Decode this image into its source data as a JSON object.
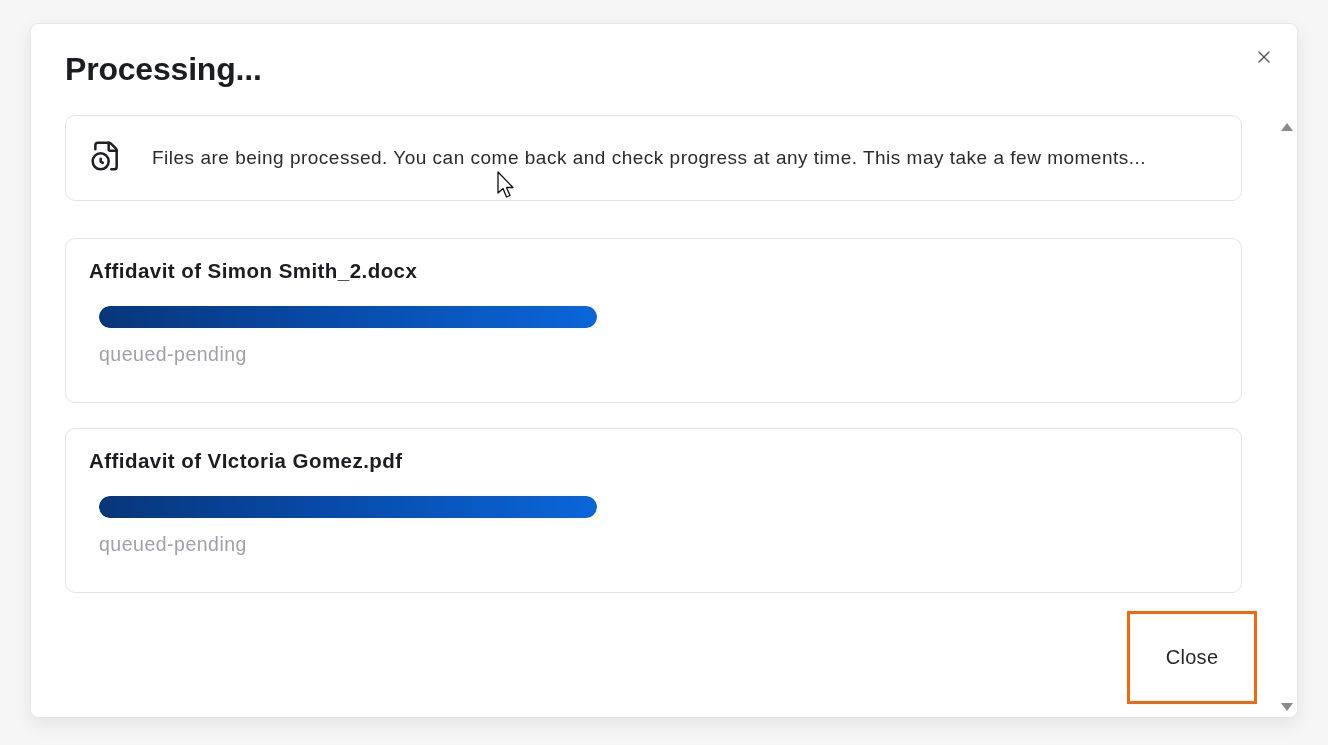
{
  "dialog": {
    "title": "Processing..."
  },
  "info_banner": {
    "message": "Files are being processed. You can come back and check progress at any time. This may take a few moments..."
  },
  "files": [
    {
      "name": "Affidavit of Simon Smith_2.docx",
      "level": 1,
      "status": "queued-pending"
    },
    {
      "name": "Affidavit of VIctoria Gomez.pdf",
      "level": 1,
      "status": "queued-pending"
    }
  ],
  "footer": {
    "close_button": {
      "label": "Close",
      "highlighted": true
    }
  }
}
